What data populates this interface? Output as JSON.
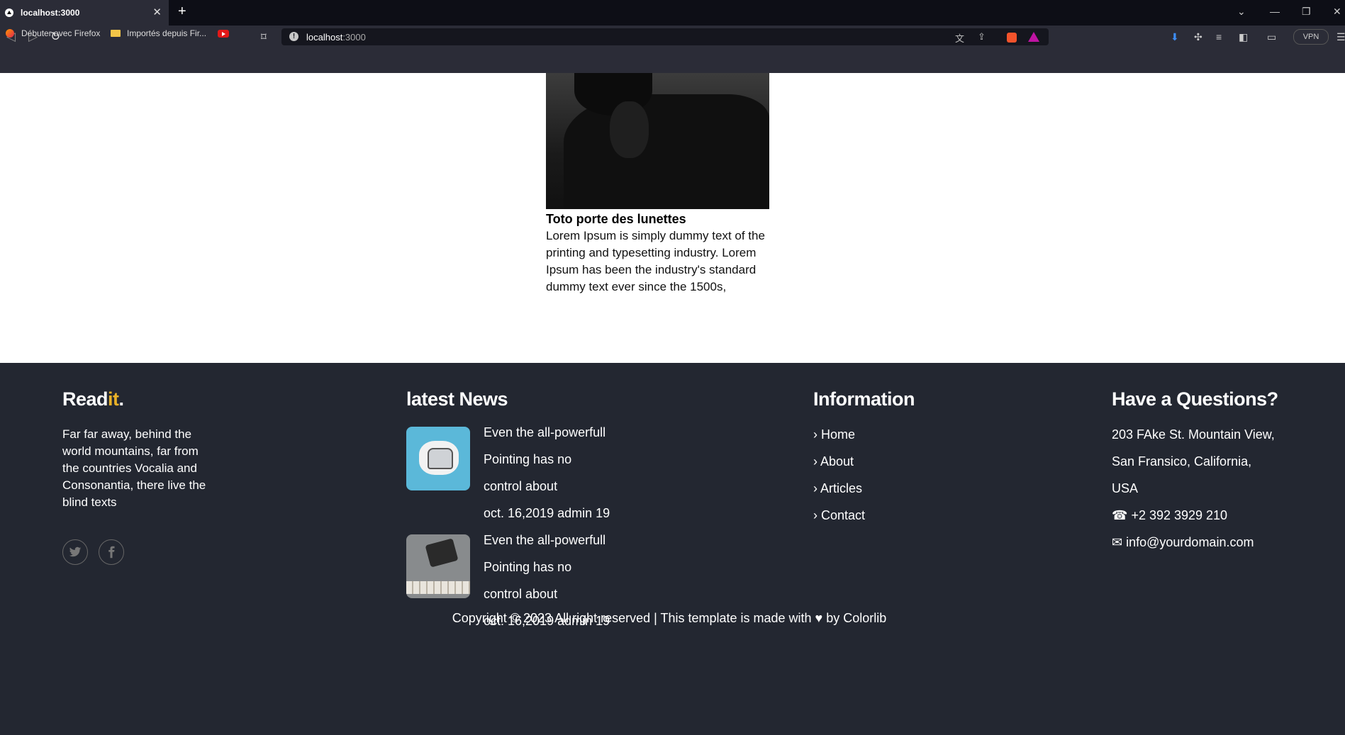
{
  "browser": {
    "tab_title": "localhost:3000",
    "url_host": "localhost",
    "url_port": ":3000",
    "bookmarks": [
      "Débuter avec Firefox",
      "Importés depuis Fir..."
    ],
    "vpn_label": "VPN"
  },
  "article": {
    "title": "Toto porte des lunettes",
    "text": "Lorem Ipsum is simply dummy text of the printing and typesetting industry. Lorem Ipsum has been the industry's standard dummy text ever since the 1500s,"
  },
  "footer": {
    "brand_main": "Read",
    "brand_accent": "it",
    "brand_dot": ".",
    "about": "Far far away, behind the world mountains, far from the countries Vocalia and Consonantia, there live the blind texts",
    "news_heading": "latest News",
    "news": [
      {
        "lines": [
          "Even the all-powerfull",
          "Pointing has no",
          "control about",
          "oct. 16,2019 admin 19"
        ]
      },
      {
        "lines": [
          "Even the all-powerfull",
          "Pointing has no",
          "control about",
          "oct. 16,2019 admin 19"
        ]
      }
    ],
    "info_heading": "Information",
    "info_links": [
      "Home",
      "About",
      "Articles",
      "Contact"
    ],
    "questions_heading": "Have a Questions?",
    "address_lines": [
      "203 FAke St. Mountain View,",
      "San Fransico, California,",
      "USA"
    ],
    "phone": "+2 392 3929 210",
    "email": "info@yourdomain.com",
    "copyright": "Copyright © 2023 All right reserved | This template is made with ♥ by Colorlib"
  },
  "colors": {
    "accent": "#e9b128",
    "footer_bg": "#232731"
  }
}
